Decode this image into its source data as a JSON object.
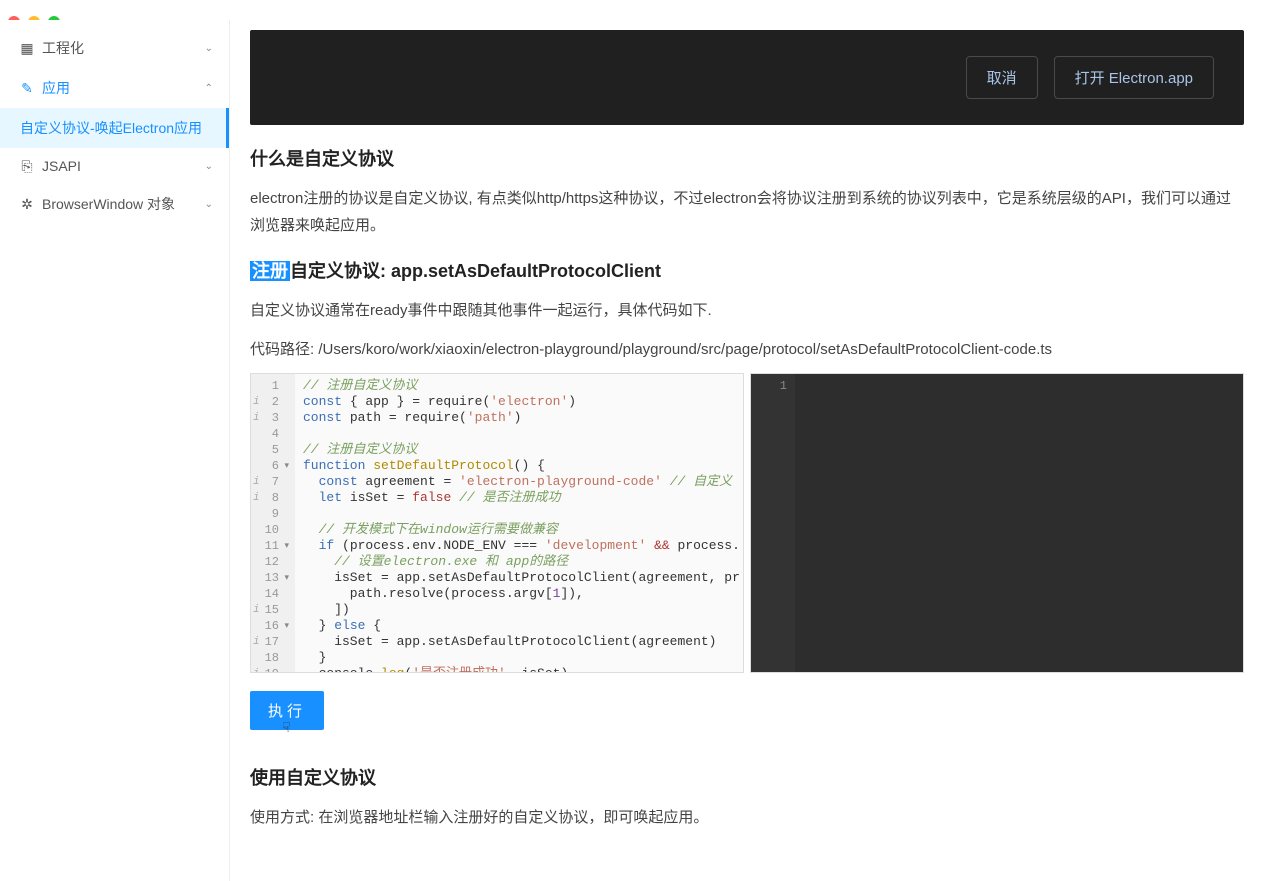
{
  "sidebar": {
    "items": [
      {
        "label": "工程化",
        "icon": "grid",
        "expanded": false
      },
      {
        "label": "应用",
        "icon": "edit",
        "expanded": true,
        "active_group": true,
        "children": [
          {
            "label": "自定义协议-唤起Electron应用",
            "active": true
          }
        ]
      },
      {
        "label": "JSAPI",
        "icon": "code",
        "expanded": false
      },
      {
        "label": "BrowserWindow 对象",
        "icon": "gear",
        "expanded": false
      }
    ]
  },
  "hero": {
    "cancel": "取消",
    "open": "打开 Electron.app"
  },
  "sections": {
    "what_title": "什么是自定义协议",
    "what_body": "electron注册的协议是自定义协议, 有点类似http/https这种协议，不过electron会将协议注册到系统的协议列表中，它是系统层级的API，我们可以通过浏览器来唤起应用。",
    "reg_highlight": "注册",
    "reg_rest": "自定义协议: app.setAsDefaultProtocolClient",
    "reg_body": "自定义协议通常在ready事件中跟随其他事件一起运行，具体代码如下.",
    "code_path_label": "代码路径: ",
    "code_path": "/Users/koro/work/xiaoxin/electron-playground/playground/src/page/protocol/setAsDefaultProtocolClient-code.ts",
    "use_title": "使用自定义协议",
    "use_body": "使用方式: 在浏览器地址栏输入注册好的自定义协议，即可唤起应用。"
  },
  "code": {
    "lines": [
      {
        "n": 1,
        "info": "",
        "fold": "",
        "html": "<span class='c-cmt'>// 注册自定义协议</span>"
      },
      {
        "n": 2,
        "info": "i",
        "fold": "",
        "html": "<span class='c-kw'>const</span> { app } = require(<span class='c-str'>'electron'</span>)"
      },
      {
        "n": 3,
        "info": "i",
        "fold": "",
        "html": "<span class='c-kw'>const</span> path = require(<span class='c-str'>'path'</span>)"
      },
      {
        "n": 4,
        "info": "",
        "fold": "",
        "html": ""
      },
      {
        "n": 5,
        "info": "",
        "fold": "",
        "html": "<span class='c-cmt'>// 注册自定义协议</span>"
      },
      {
        "n": 6,
        "info": "",
        "fold": "▾",
        "html": "<span class='c-kw'>function</span> <span class='c-fn'>setDefaultProtocol</span>() {"
      },
      {
        "n": 7,
        "info": "i",
        "fold": "",
        "html": "  <span class='c-kw'>const</span> agreement = <span class='c-str'>'electron-playground-code'</span> <span class='c-cmt'>// 自定义</span>"
      },
      {
        "n": 8,
        "info": "i",
        "fold": "",
        "html": "  <span class='c-kw'>let</span> isSet = <span class='c-const'>false</span> <span class='c-cmt'>// 是否注册成功</span>"
      },
      {
        "n": 9,
        "info": "",
        "fold": "",
        "html": ""
      },
      {
        "n": 10,
        "info": "",
        "fold": "",
        "html": "  <span class='c-cmt'>// 开发模式下在window运行需要做兼容</span>"
      },
      {
        "n": 11,
        "info": "",
        "fold": "▾",
        "html": "  <span class='c-kw'>if</span> (process.env.NODE_ENV === <span class='c-str'>'development'</span> <span class='c-const'>&&</span> process."
      },
      {
        "n": 12,
        "info": "",
        "fold": "",
        "html": "    <span class='c-cmt'>// 设置electron.exe 和 app的路径</span>"
      },
      {
        "n": 13,
        "info": "",
        "fold": "▾",
        "html": "    isSet = app.setAsDefaultProtocolClient(agreement, pr"
      },
      {
        "n": 14,
        "info": "",
        "fold": "",
        "html": "      path.resolve(process.argv[<span class='c-num'>1</span>]),"
      },
      {
        "n": 15,
        "info": "i",
        "fold": "",
        "html": "    ])"
      },
      {
        "n": 16,
        "info": "",
        "fold": "▾",
        "html": "  } <span class='c-kw'>else</span> {"
      },
      {
        "n": 17,
        "info": "i",
        "fold": "",
        "html": "    isSet = app.setAsDefaultProtocolClient(agreement)"
      },
      {
        "n": 18,
        "info": "",
        "fold": "",
        "html": "  }"
      },
      {
        "n": 19,
        "info": "i",
        "fold": "",
        "html": "  console.<span class='c-fn'>log</span>(<span class='c-str'>'是否注册成功'</span>, isSet)"
      }
    ]
  },
  "output": {
    "line1": "1"
  },
  "run_label": "执行"
}
